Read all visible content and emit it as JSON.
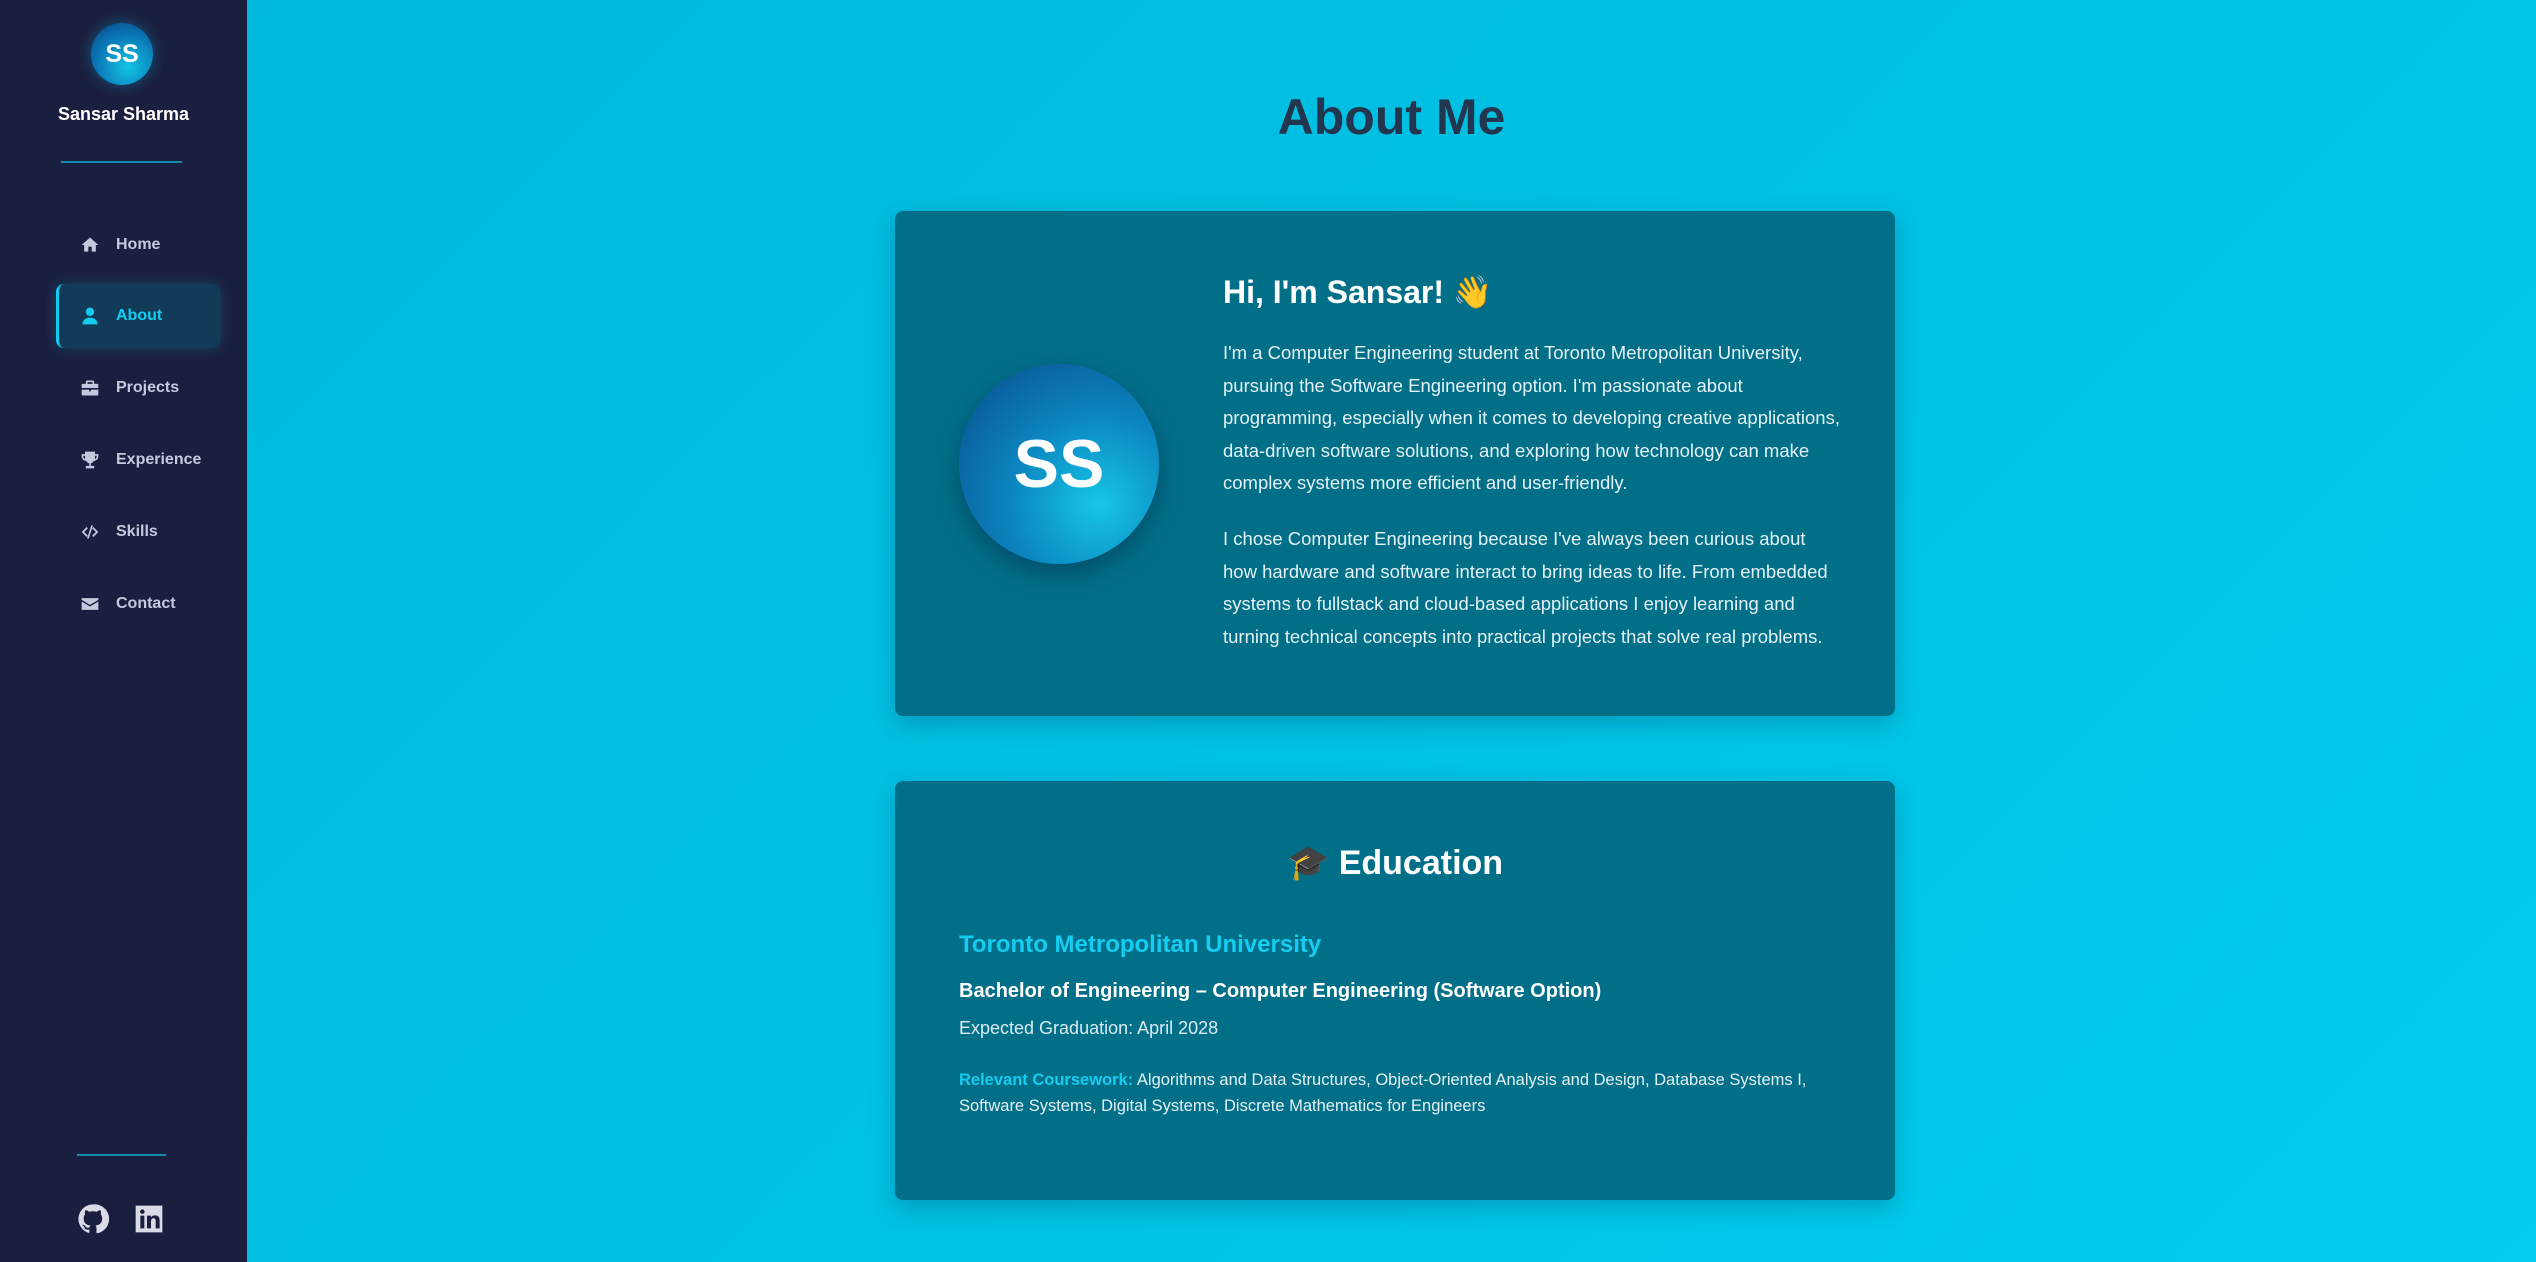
{
  "sidebar": {
    "avatar_initials": "SS",
    "name": "Sansar Sharma",
    "nav": [
      {
        "label": "Home",
        "icon": "home-icon"
      },
      {
        "label": "About",
        "icon": "user-icon",
        "active": true
      },
      {
        "label": "Projects",
        "icon": "briefcase-icon"
      },
      {
        "label": "Experience",
        "icon": "trophy-icon"
      },
      {
        "label": "Skills",
        "icon": "code-icon"
      },
      {
        "label": "Contact",
        "icon": "envelope-icon"
      }
    ],
    "social": [
      "github-icon",
      "linkedin-icon"
    ]
  },
  "main": {
    "title": "About Me",
    "intro": {
      "avatar_initials": "SS",
      "heading": "Hi, I'm Sansar! 👋",
      "paragraph1": "I'm a Computer Engineering student at Toronto Metropolitan University, pursuing the Software Engineering option. I'm passionate about programming, especially when it comes to developing creative applications, data-driven software solutions, and exploring how technology can make complex systems more efficient and user-friendly.",
      "paragraph2": "I chose Computer Engineering because I've always been curious about how hardware and software interact to bring ideas to life. From embedded systems to fullstack and cloud-based applications I enjoy learning and turning technical concepts into practical projects that solve real problems."
    },
    "education": {
      "heading": "🎓 Education",
      "university": "Toronto Metropolitan University",
      "degree": "Bachelor of Engineering – Computer Engineering (Software Option)",
      "graduation": "Expected Graduation: April 2028",
      "coursework_label": "Relevant Coursework:",
      "coursework": " Algorithms and Data Structures, Object-Oriented Analysis and Design, Database Systems I, Software Systems, Digital Systems, Discrete Mathematics for Engineers"
    }
  },
  "colors": {
    "sidebar_bg": "#1b1f3f",
    "page_bg": "#00c0e2",
    "card_bg": "#026f89",
    "accent": "#12cdf0",
    "title": "#233650"
  }
}
